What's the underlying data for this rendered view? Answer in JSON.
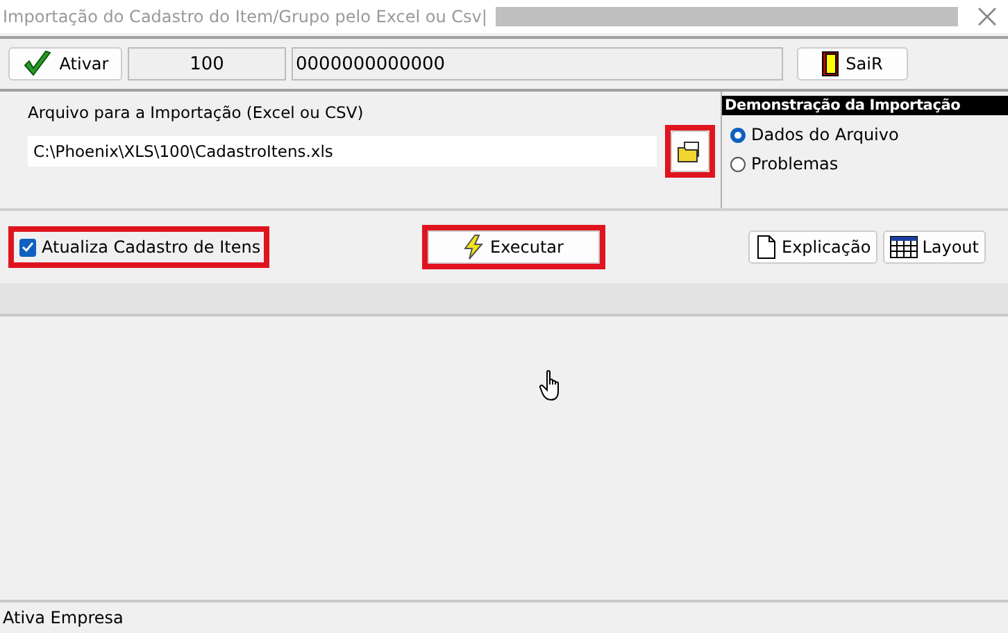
{
  "window": {
    "title": "Importação do Cadastro do Item/Grupo pelo Excel ou Csv|"
  },
  "toolbar": {
    "activate_button": {
      "label": "Ativar"
    },
    "code": "100",
    "number": "0000000000000",
    "exit_button": {
      "label": "SaiR"
    }
  },
  "file": {
    "label": "Arquivo para a Importação (Excel ou CSV)",
    "value": "C:\\Phoenix\\XLS\\100\\CadastroItens.xls",
    "browse_highlighted": true
  },
  "demo": {
    "title": "Demonstração da Importação",
    "options": [
      {
        "label": "Dados do Arquivo",
        "selected": true
      },
      {
        "label": "Problemas",
        "selected": false
      }
    ]
  },
  "update_checkbox": {
    "label": "Atualiza Cadastro de Itens",
    "checked": true,
    "highlighted": true
  },
  "execute_button": {
    "label": "Executar",
    "highlighted": true
  },
  "buttons": [
    {
      "label": "Explicação",
      "kind": "doc"
    },
    {
      "label": "Layout",
      "kind": "grid"
    }
  ],
  "status_bar": "Ativa Empresa"
}
